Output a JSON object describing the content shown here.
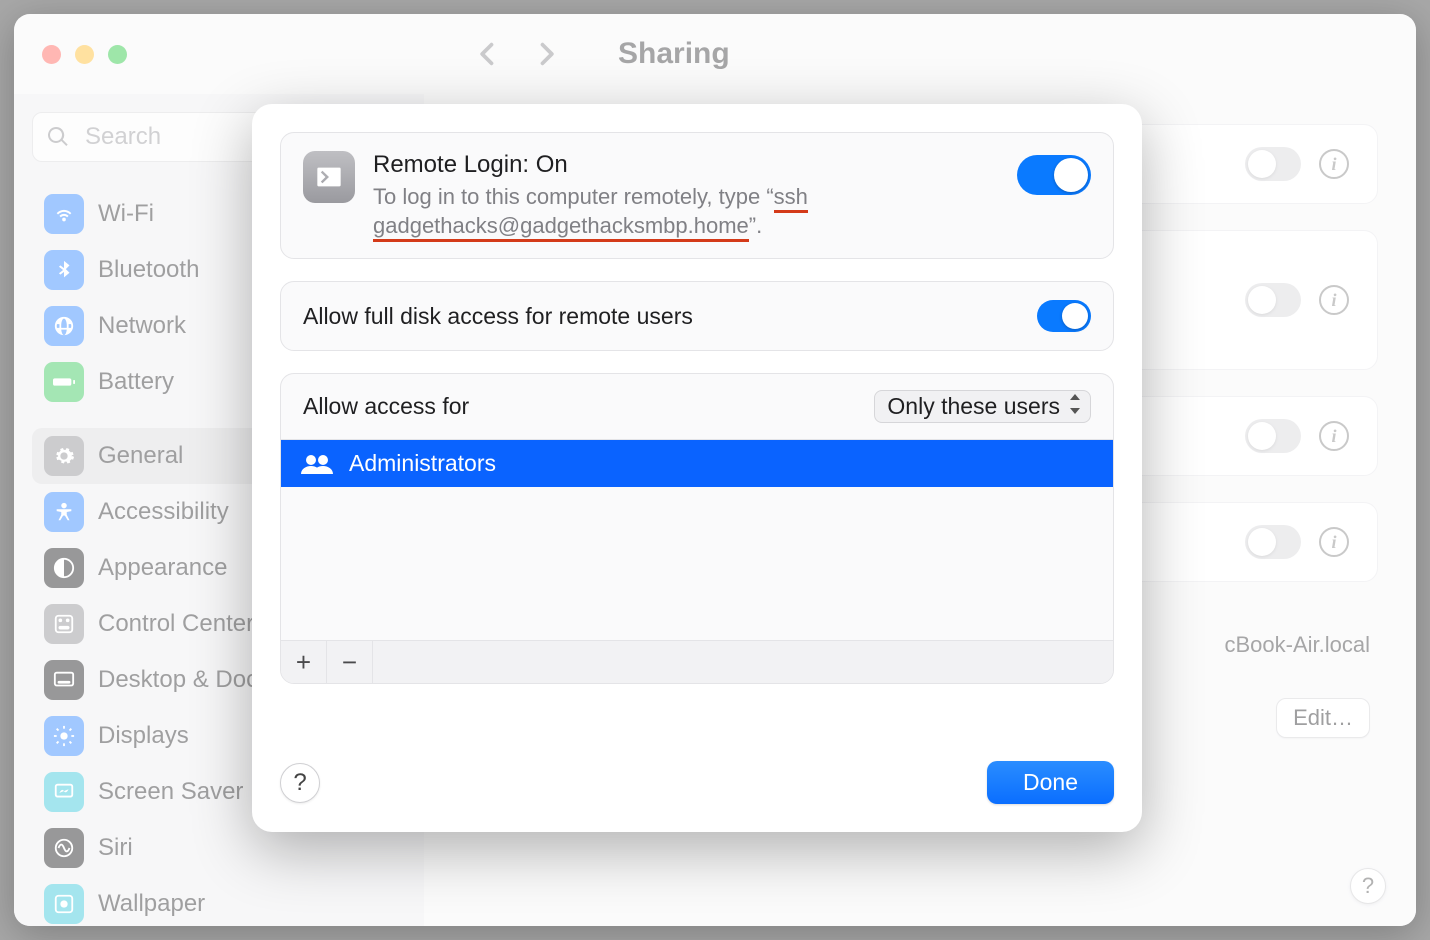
{
  "header": {
    "title": "Sharing"
  },
  "search": {
    "placeholder": "Search"
  },
  "sidebar": {
    "items": [
      {
        "label": "Wi-Fi",
        "color": "#2f86ff",
        "icon": "wifi"
      },
      {
        "label": "Bluetooth",
        "color": "#2f86ff",
        "icon": "bluetooth"
      },
      {
        "label": "Network",
        "color": "#2f86ff",
        "icon": "globe"
      },
      {
        "label": "Battery",
        "color": "#35c759",
        "icon": "battery"
      },
      {
        "label": "General",
        "color": "#8e8e93",
        "icon": "gear",
        "selected": true
      },
      {
        "label": "Accessibility",
        "color": "#2f86ff",
        "icon": "accessibility"
      },
      {
        "label": "Appearance",
        "color": "#1c1c1e",
        "icon": "appearance"
      },
      {
        "label": "Control Center",
        "color": "#8e8e93",
        "icon": "panel"
      },
      {
        "label": "Desktop & Dock",
        "color": "#1c1c1e",
        "icon": "dock"
      },
      {
        "label": "Displays",
        "color": "#2f86ff",
        "icon": "sun"
      },
      {
        "label": "Screen Saver",
        "color": "#35c5d9",
        "icon": "screensaver"
      },
      {
        "label": "Siri",
        "color": "#1c1c1e",
        "icon": "siri"
      },
      {
        "label": "Wallpaper",
        "color": "#35c5d9",
        "icon": "wallpaper"
      }
    ]
  },
  "background_rows": {
    "r1": {
      "on": false
    },
    "r2": {
      "on": false
    },
    "r3": {
      "on": false
    },
    "r4": {
      "on": false
    },
    "hostname_suffix": "cBook-Air.local",
    "edit_label": "Edit…"
  },
  "sheet": {
    "remote_login": {
      "title": "Remote Login: On",
      "sub_pre": "To log in to this computer remotely, type “",
      "sub_cmd1": "ssh",
      "sub_cmd2": "gadgethacks@gadgethacksmbp.home",
      "sub_post": "”.",
      "on": true
    },
    "full_disk": {
      "label": "Allow full disk access for remote users",
      "on": true
    },
    "access": {
      "label": "Allow access for",
      "mode": "Only these users",
      "users": [
        {
          "label": "Administrators"
        }
      ]
    },
    "footer": {
      "done": "Done"
    }
  }
}
